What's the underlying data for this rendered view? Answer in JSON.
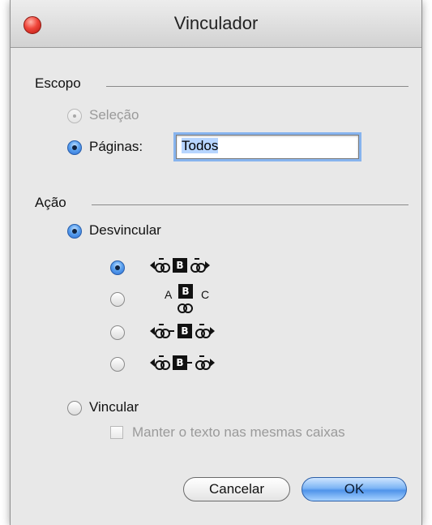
{
  "window": {
    "title": "Vinculador"
  },
  "scope": {
    "label": "Escopo",
    "option_selection": "Seleção",
    "option_pages": "Páginas:",
    "pages_value": "Todos"
  },
  "action": {
    "label": "Ação",
    "unlink_label": "Desvincular",
    "unlink_variants": [
      {
        "selected": true,
        "icon": "unlink-before-after-icon"
      },
      {
        "selected": false,
        "icon": "unlink-sequence-icon",
        "letters": [
          "A",
          "B",
          "C"
        ]
      },
      {
        "selected": false,
        "icon": "unlink-before-icon"
      },
      {
        "selected": false,
        "icon": "unlink-after-icon"
      }
    ],
    "link_label": "Vincular",
    "keep_text_label": "Manter o texto nas mesmas caixas"
  },
  "buttons": {
    "cancel": "Cancelar",
    "ok": "OK"
  },
  "box_letter": "B",
  "colors": {
    "accent": "#4f93ea",
    "window_bg": "#e8e8e8",
    "close": "#f0463b"
  }
}
